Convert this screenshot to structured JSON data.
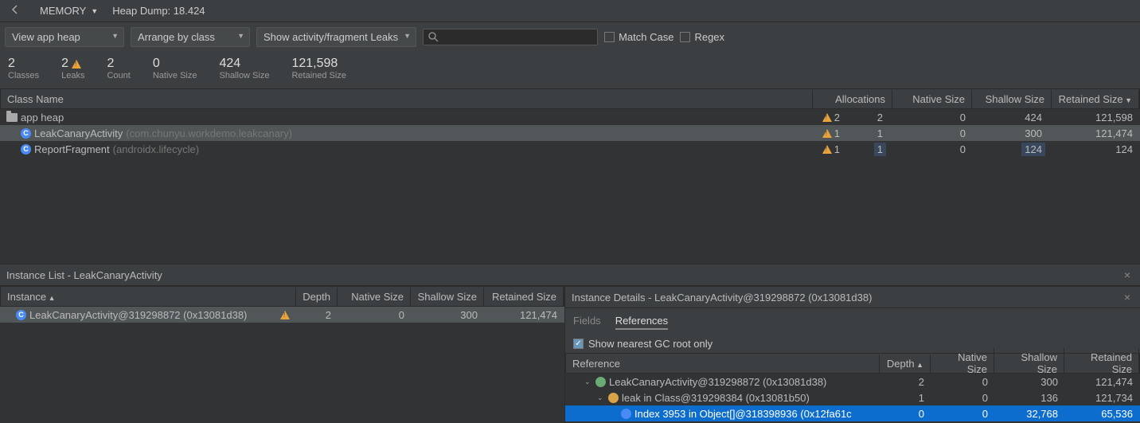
{
  "topbar": {
    "memory_tab": "MEMORY",
    "heap_dump": "Heap Dump: 18.424"
  },
  "toolbar": {
    "view_heap": "View app heap",
    "arrange": "Arrange by class",
    "filter": "Show activity/fragment Leaks",
    "search_placeholder": "",
    "match_case": "Match Case",
    "regex": "Regex"
  },
  "stats": {
    "classes": {
      "v": "2",
      "l": "Classes"
    },
    "leaks": {
      "v": "2",
      "l": "Leaks"
    },
    "count": {
      "v": "2",
      "l": "Count"
    },
    "native": {
      "v": "0",
      "l": "Native Size"
    },
    "shallow": {
      "v": "424",
      "l": "Shallow Size"
    },
    "retained": {
      "v": "121,598",
      "l": "Retained Size"
    }
  },
  "headers": {
    "class_name": "Class Name",
    "allocations": "Allocations",
    "native_size": "Native Size",
    "shallow_size": "Shallow Size",
    "retained_size": "Retained Size"
  },
  "rows": [
    {
      "name": "app heap",
      "pkg": "",
      "kind": "folder",
      "warn": "2",
      "alloc": "2",
      "native": "0",
      "shallow": "424",
      "retained": "121,598",
      "indent": 0
    },
    {
      "name": "LeakCanaryActivity",
      "pkg": "(com.chunyu.workdemo.leakcanary)",
      "kind": "class",
      "warn": "1",
      "alloc": "1",
      "native": "0",
      "shallow": "300",
      "retained": "121,474",
      "indent": 1,
      "hl": true
    },
    {
      "name": "ReportFragment",
      "pkg": "(androidx.lifecycle)",
      "kind": "class",
      "warn": "1",
      "alloc": "1",
      "native": "0",
      "shallow": "124",
      "retained": "124",
      "indent": 1,
      "hlcells": true
    }
  ],
  "instance_panel": {
    "title": "Instance List - LeakCanaryActivity",
    "headers": {
      "instance": "Instance",
      "depth": "Depth",
      "native": "Native Size",
      "shallow": "Shallow Size",
      "retained": "Retained Size"
    },
    "rows": [
      {
        "name": "LeakCanaryActivity@319298872 (0x13081d38)",
        "warn": true,
        "depth": "2",
        "native": "0",
        "shallow": "300",
        "retained": "121,474",
        "hl": true
      }
    ]
  },
  "details_panel": {
    "title": "Instance Details - LeakCanaryActivity@319298872 (0x13081d38)",
    "tabs": {
      "fields": "Fields",
      "references": "References"
    },
    "gc_check": "Show nearest GC root only",
    "headers": {
      "reference": "Reference",
      "depth": "Depth",
      "native": "Native Size",
      "shallow": "Shallow Size",
      "retained": "Retained Size"
    },
    "rows": [
      {
        "name": "LeakCanaryActivity@319298872 (0x13081d38)",
        "indent": 1,
        "color": "#6aab73",
        "depth": "2",
        "native": "0",
        "shallow": "300",
        "retained": "121,474",
        "exp": "⌄"
      },
      {
        "name": "leak in Class@319298384 (0x13081b50)",
        "indent": 2,
        "color": "#d9a34a",
        "depth": "1",
        "native": "0",
        "shallow": "136",
        "retained": "121,734",
        "exp": "⌄"
      },
      {
        "name": "Index 3953 in Object[]@318398936 (0x12fa61c",
        "indent": 3,
        "color": "#4a8af4",
        "depth": "0",
        "native": "0",
        "shallow": "32,768",
        "retained": "65,536",
        "selected": true
      }
    ]
  }
}
